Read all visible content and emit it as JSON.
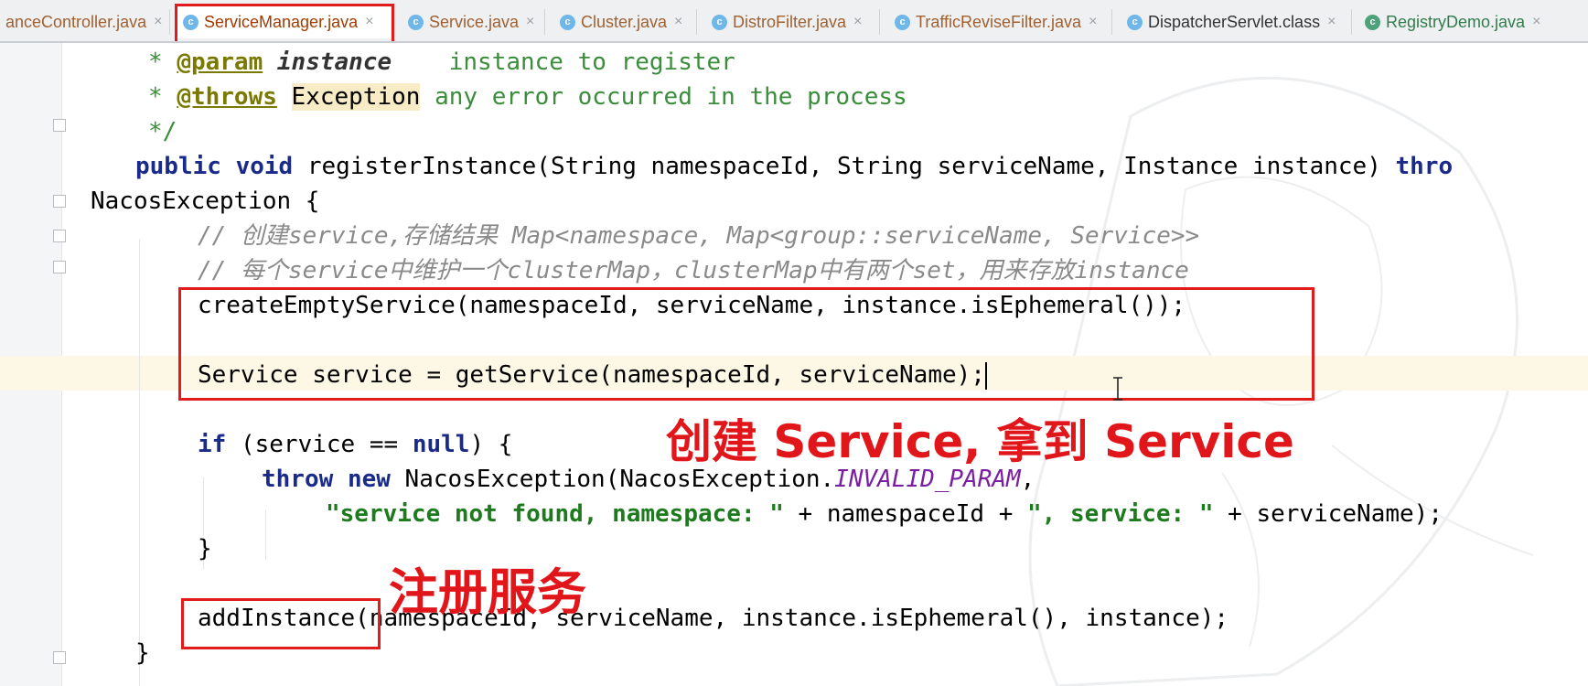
{
  "tabs": [
    {
      "label": "anceController.java",
      "icon": "",
      "close": "×",
      "active": false
    },
    {
      "label": "ServiceManager.java",
      "icon": "c",
      "close": "×",
      "active": true
    },
    {
      "label": "Service.java",
      "icon": "c",
      "close": "×",
      "active": false
    },
    {
      "label": "Cluster.java",
      "icon": "c",
      "close": "×",
      "active": false
    },
    {
      "label": "DistroFilter.java",
      "icon": "c",
      "close": "×",
      "active": false
    },
    {
      "label": "TrafficReviseFilter.java",
      "icon": "c",
      "close": "×",
      "active": false
    },
    {
      "label": "DispatcherServlet.class",
      "icon": "c",
      "close": "×",
      "active": false
    },
    {
      "label": "RegistryDemo.java",
      "icon": "c",
      "close": "×",
      "active": false
    }
  ],
  "code": {
    "l1_star": "* ",
    "l1_tag": "@param",
    "l1_name": "instance",
    "l1_text": "    instance to register",
    "l2_star": "* ",
    "l2_tag": "@throws",
    "l2_exc": "Exception",
    "l2_text": " any error occurred in the process",
    "l3": "*/",
    "l4_kw1": "public",
    "l4_kw2": "void",
    "l4_text": " registerInstance(String namespaceId, String serviceName, Instance instance) ",
    "l4_kw3": "thro",
    "l5": "NacosException {",
    "l6": "// 创建service,存储结果 Map<namespace, Map<group::serviceName, Service>>",
    "l7": "// 每个service中维护一个clusterMap，clusterMap中有两个set，用来存放instance",
    "l8": "createEmptyService(namespaceId, serviceName, instance.isEphemeral());",
    "l9": "Service service = getService(namespaceId, serviceName);",
    "l10_kw1": "if",
    "l10_text1": " (service == ",
    "l10_kw2": "null",
    "l10_text2": ") {",
    "l11_kw1": "throw",
    "l11_kw2": "new",
    "l11_text": " NacosException(NacosException.",
    "l11_const": "INVALID_PARAM",
    "l11_end": ",",
    "l12_str1": "\"service not found, namespace: \"",
    "l12_mid": " + namespaceId + ",
    "l12_str2": "\", service: \"",
    "l12_end": " + serviceName);",
    "l13": "}",
    "l14": "addInstance(namespaceId, serviceName, instance.isEphemeral(), instance);",
    "l15": "}"
  },
  "annotations": {
    "create_service": "创建 Service, 拿到 Service",
    "register_service": "注册服务"
  }
}
